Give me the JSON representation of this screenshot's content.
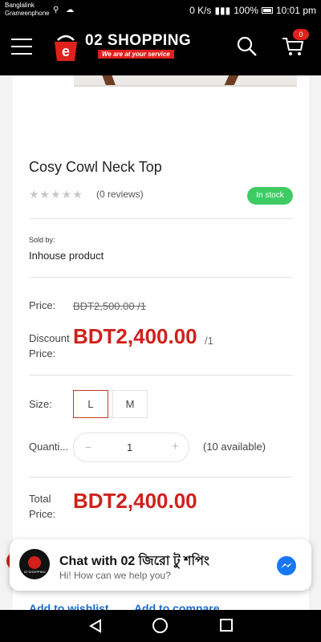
{
  "status_bar": {
    "carrier_1": "Banglalink",
    "carrier_2": "Grameenphone",
    "speed": "0 K/s",
    "battery": "100%",
    "time": "10:01 pm"
  },
  "header": {
    "brand": "02 SHOPPING",
    "tagline": "We are at your service",
    "cart_count": "0",
    "icons": [
      "menu-icon",
      "search-icon",
      "cart-icon"
    ]
  },
  "product": {
    "title": "Cosy Cowl Neck Top",
    "stars": "★★★★★",
    "rating": 0,
    "reviews": "(0 reviews)",
    "stock": "In stock",
    "sold_by_label": "Sold by:",
    "sold_by": "Inhouse product",
    "price_label": "Price:",
    "old_price": "BDT2,500.00 /1",
    "discount_label_1": "Discount",
    "discount_label_2": "Price:",
    "discount_price": "BDT2,400.00",
    "discount_unit": "/1",
    "size_label": "Size:",
    "sizes": [
      "L",
      "M"
    ],
    "selected_size": "L",
    "quantity_label": "Quanti...",
    "qty_minus": "−",
    "quantity": "1",
    "qty_plus": "+",
    "available": "(10 available)",
    "total_label_1": "Total",
    "total_label_2": "Price:",
    "total_price": "BDT2,400.00"
  },
  "actions": {
    "wishlist": "Add to wishlist",
    "compare": "Add to compare"
  },
  "chat": {
    "title": "Chat with 02 জিরো টু শপিং",
    "subtitle": "Hi! How can we help you?"
  },
  "colors": {
    "accent_red": "#d0211b",
    "in_stock_green": "#3fcb63",
    "link_blue": "#1e6bc9"
  }
}
